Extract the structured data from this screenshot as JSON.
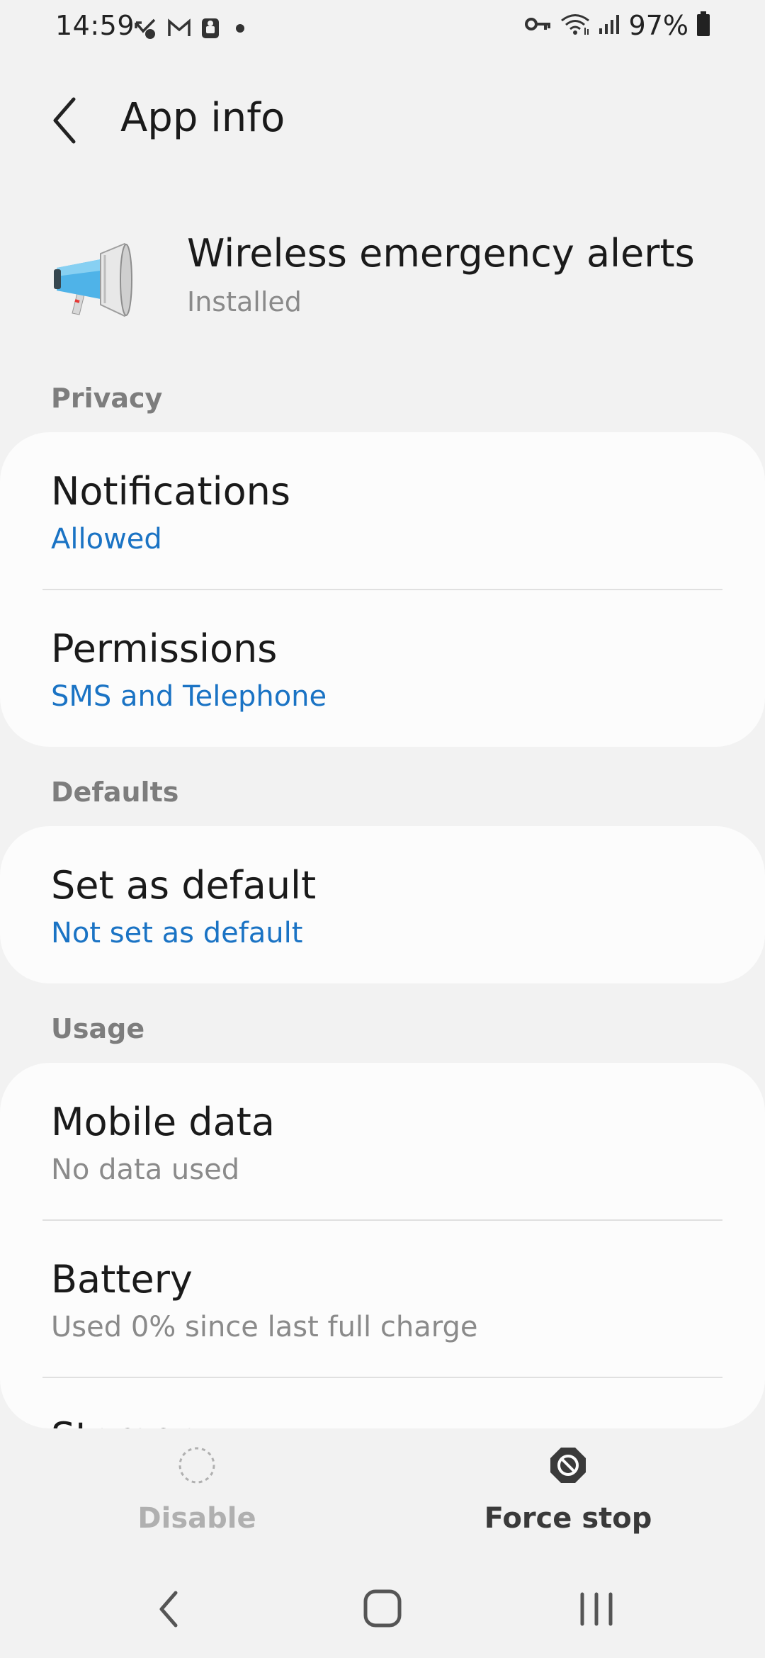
{
  "status_bar": {
    "time": "14:59",
    "battery_percent": "97%",
    "left_icons": [
      "missed-call-icon",
      "gmail-icon",
      "sim-icon",
      "dot-icon"
    ],
    "right_icons": [
      "vpn-key-icon",
      "wifi-icon",
      "signal-icon",
      "battery-icon"
    ]
  },
  "header": {
    "title": "App info"
  },
  "app": {
    "name": "Wireless emergency alerts",
    "status": "Installed",
    "icon": "megaphone-icon"
  },
  "sections": {
    "privacy": {
      "header": "Privacy",
      "notifications": {
        "title": "Notifications",
        "subtitle": "Allowed"
      },
      "permissions": {
        "title": "Permissions",
        "subtitle": "SMS and Telephone"
      }
    },
    "defaults": {
      "header": "Defaults",
      "set_as_default": {
        "title": "Set as default",
        "subtitle": "Not set as default"
      }
    },
    "usage": {
      "header": "Usage",
      "mobile_data": {
        "title": "Mobile data",
        "subtitle": "No data used"
      },
      "battery": {
        "title": "Battery",
        "subtitle": "Used 0% since last full charge"
      },
      "storage": {
        "title": "Storage"
      }
    }
  },
  "actions": {
    "disable_label": "Disable",
    "force_stop_label": "Force stop"
  },
  "colors": {
    "background": "#f2f2f2",
    "card": "#fcfcfc",
    "accent_blue": "#1a73c4",
    "secondary_text": "#8a8a8a",
    "section_header": "#7d7d7d",
    "disabled_text": "#b0b0b0"
  }
}
